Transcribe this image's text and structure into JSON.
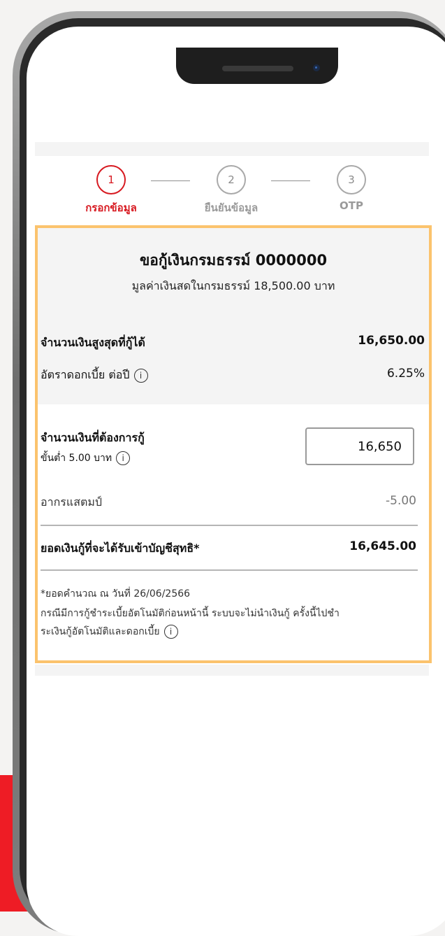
{
  "steps": [
    {
      "num": "1",
      "label": "กรอกข้อมูล"
    },
    {
      "num": "2",
      "label": "ยืนยันข้อมูล"
    },
    {
      "num": "3",
      "label": "OTP"
    }
  ],
  "card": {
    "title": "ขอกู้เงินกรมธรรม์ 0000000",
    "subtitle": "มูลค่าเงินสดในกรมธรรม์ 18,500.00 บาท",
    "max_loan_label": "จำนวนเงินสูงสุดที่กู้ได้",
    "max_loan_value": "16,650.00",
    "interest_label": "อัตราดอกเบี้ย ต่อปี",
    "interest_value": "6.25%",
    "request_label": "จำนวนเงินที่ต้องการกู้",
    "request_min_label": "ขั้นต่ำ 5.00 บาท",
    "request_value": "16,650",
    "stamp_label": "อากรแสตมป์",
    "stamp_value": "-5.00",
    "net_label": "ยอดเงินกู้ที่จะได้รับเข้าบัญชีสุทธิ*",
    "net_value": "16,645.00",
    "note_line1": "*ยอดคำนวณ ณ วันที่ 26/06/2566",
    "note_line2": "กรณีมีการกู้ชำระเบี้ยอัตโนมัติก่อนหน้านี้ ระบบจะไม่นำเงินกู้ ครั้งนี้ไปชำ",
    "note_line3": "ระเงินกู้อัตโนมัติและดอกเบี้ย"
  },
  "icons": {
    "info": "info-icon",
    "info_glyph": "i"
  },
  "colors": {
    "accent_red": "#d71920",
    "card_border": "#fbc36d",
    "background_red": "#ee1c25"
  }
}
